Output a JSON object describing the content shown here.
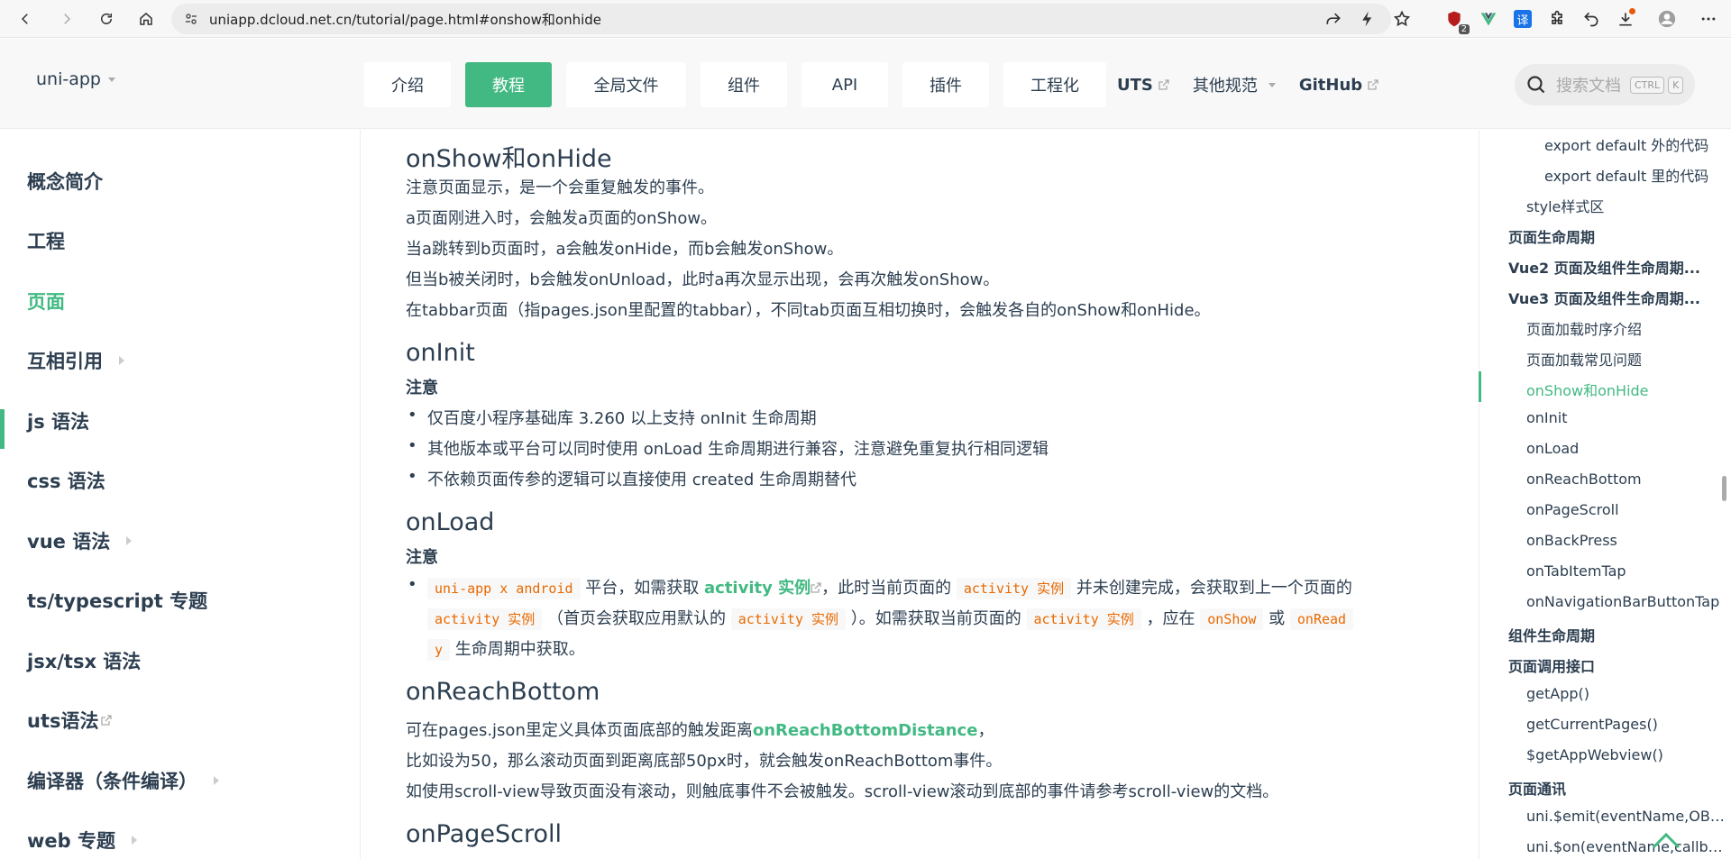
{
  "browser": {
    "url": "uniapp.dcloud.net.cn/tutorial/page.html#onshow和onhide",
    "ext_badge": "2"
  },
  "header": {
    "logo": "uni-app",
    "tabs": [
      {
        "label": "介绍"
      },
      {
        "label": "教程"
      },
      {
        "label": "全局文件"
      },
      {
        "label": "组件"
      },
      {
        "label": "API"
      },
      {
        "label": "插件"
      },
      {
        "label": "工程化"
      }
    ],
    "links": {
      "uts": "UTS",
      "other": "其他规范",
      "github": "GitHub"
    },
    "search": {
      "placeholder": "搜索文档",
      "key1": "CTRL",
      "key2": "K"
    }
  },
  "sidebar": {
    "items": [
      {
        "label": "概念简介"
      },
      {
        "label": "工程"
      },
      {
        "label": "页面"
      },
      {
        "label": "互相引用"
      },
      {
        "label": "js 语法"
      },
      {
        "label": "css 语法"
      },
      {
        "label": "vue 语法"
      },
      {
        "label": "ts/typescript 专题"
      },
      {
        "label": "jsx/tsx 语法"
      },
      {
        "label": "uts语法"
      },
      {
        "label": "编译器（条件编译）"
      },
      {
        "label": "web 专题"
      }
    ]
  },
  "content": {
    "onshow": {
      "title": "onShow和onHide",
      "lines": [
        "注意页面显示，是一个会重复触发的事件。",
        "a页面刚进入时，会触发a页面的onShow。",
        "当a跳转到b页面时，a会触发onHide，而b会触发onShow。",
        "但当b被关闭时，b会触发onUnload，此时a再次显示出现，会再次触发onShow。",
        "在tabbar页面（指pages.json里配置的tabbar），不同tab页面互相切换时，会触发各自的onShow和onHide。"
      ]
    },
    "oninit": {
      "title": "onInit",
      "note": "注意",
      "items": [
        "仅百度小程序基础库 3.260 以上支持 onInit 生命周期",
        "其他版本或平台可以同时使用 onLoad 生命周期进行兼容，注意避免重复执行相同逻辑",
        "不依赖页面传参的逻辑可以直接使用 created 生命周期替代"
      ]
    },
    "onload": {
      "title": "onLoad",
      "note": "注意",
      "code1": "uni-app x android",
      "t1": "平台，如需获取",
      "link": "activity 实例",
      "t2": "，此时当前页面的",
      "code2": "activity 实例",
      "t3": "并未创建完成，会获取到上一个页面的",
      "code3": "activity 实例",
      "t4": "（首页会获取应用默认的",
      "code4": "activity 实例",
      "t5": "）。如需获取当前页面的",
      "code5": "activity 实例",
      "t6": "，应在",
      "code6": "onShow",
      "t7": "或",
      "code7a": "onRead",
      "code7b": "y",
      "t8": "生命周期中获取。"
    },
    "onreach": {
      "title": "onReachBottom",
      "l1a": "可在pages.json里定义具体页面底部的触发距离",
      "l1link": "onReachBottomDistance",
      "l1b": "，",
      "l2": "比如设为50，那么滚动页面到距离底部50px时，就会触发onReachBottom事件。",
      "l3": "如使用scroll-view导致页面没有滚动，则触底事件不会被触发。scroll-view滚动到底部的事件请参考scroll-view的文档。"
    },
    "onscroll": {
      "title": "onPageScroll"
    }
  },
  "toc": {
    "items": [
      {
        "label": "export default 外的代码"
      },
      {
        "label": "export default 里的代码"
      },
      {
        "label": "style样式区"
      },
      {
        "label": "页面生命周期"
      },
      {
        "label": "Vue2 页面及组件生命周期..."
      },
      {
        "label": "Vue3 页面及组件生命周期..."
      },
      {
        "label": "页面加载时序介绍"
      },
      {
        "label": "页面加载常见问题"
      },
      {
        "label": "onShow和onHide"
      },
      {
        "label": "onInit"
      },
      {
        "label": "onLoad"
      },
      {
        "label": "onReachBottom"
      },
      {
        "label": "onPageScroll"
      },
      {
        "label": "onBackPress"
      },
      {
        "label": "onTabItemTap"
      },
      {
        "label": "onNavigationBarButtonTap"
      },
      {
        "label": "组件生命周期"
      },
      {
        "label": "页面调用接口"
      },
      {
        "label": "getApp()"
      },
      {
        "label": "getCurrentPages()"
      },
      {
        "label": "$getAppWebview()"
      },
      {
        "label": "页面通讯"
      },
      {
        "label": "uni.$emit(eventName,OBJ..."
      },
      {
        "label": "uni.$on(eventName,callba..."
      }
    ]
  }
}
